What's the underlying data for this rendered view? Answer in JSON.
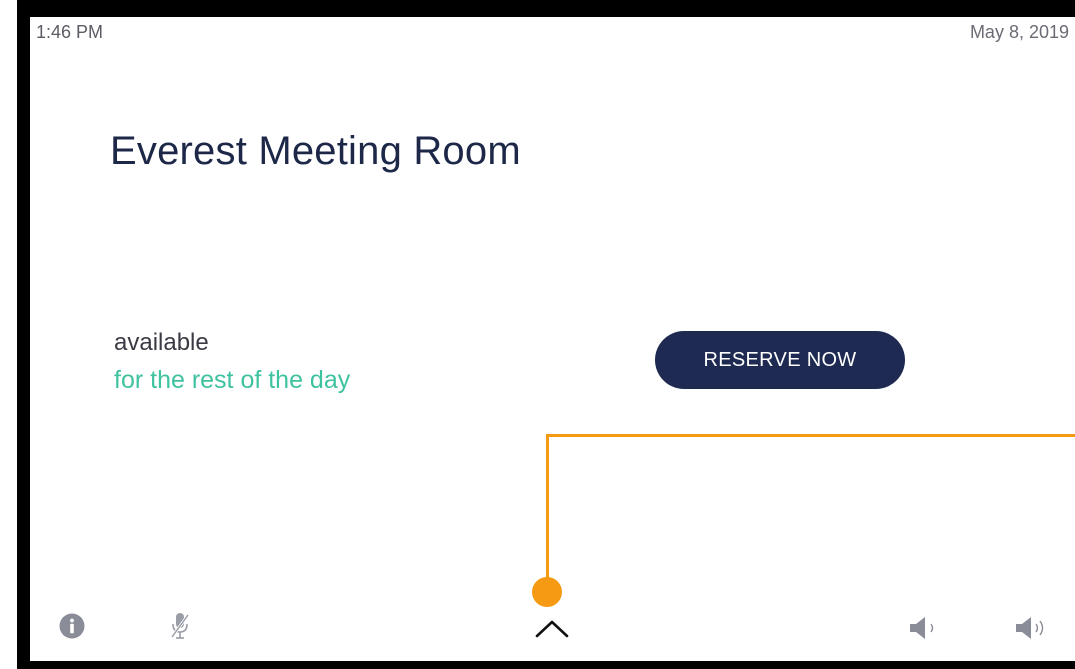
{
  "status_bar": {
    "time": "1:46 PM",
    "date": "May 8, 2019"
  },
  "room": {
    "name": "Everest Meeting Room",
    "status": "available",
    "status_detail": "for the rest of the day"
  },
  "actions": {
    "reserve_label": "RESERVE NOW"
  },
  "footer": {
    "icons": [
      "info-icon",
      "microphone-muted-icon",
      "chevron-up-icon",
      "volume-down-icon",
      "volume-up-icon"
    ]
  },
  "colors": {
    "title": "#1d2748",
    "accent_green": "#3fc2a0",
    "button_bg": "#1e2a52",
    "callout": "#f59a12",
    "icon_gray": "#8a8d98"
  }
}
